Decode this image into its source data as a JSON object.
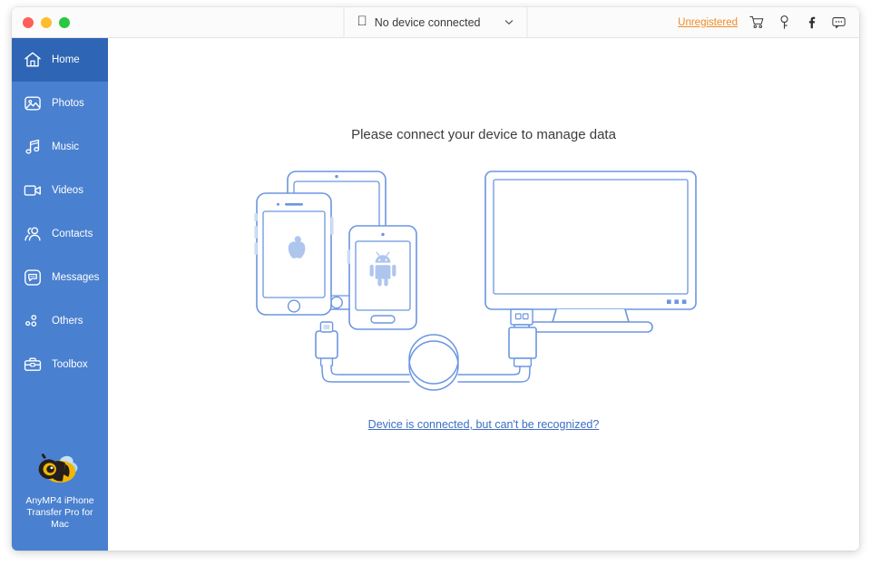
{
  "window": {
    "traffic_lights": [
      {
        "name": "close",
        "color": "#ff5f57"
      },
      {
        "name": "minimize",
        "color": "#febc2e"
      },
      {
        "name": "zoom",
        "color": "#28c840"
      }
    ]
  },
  "titlebar": {
    "device_selector": {
      "icon": "apple-icon",
      "value": "No device connected",
      "chevron": "chevron-down-icon"
    },
    "right": {
      "unregistered_label": "Unregistered",
      "unregistered_color": "#f08c28",
      "icons": [
        {
          "name": "cart-icon",
          "label": "Cart"
        },
        {
          "name": "key-icon",
          "label": "Register key"
        },
        {
          "name": "facebook-icon",
          "label": "Facebook"
        },
        {
          "name": "feedback-icon",
          "label": "Feedback"
        }
      ]
    }
  },
  "sidebar": {
    "background": "#4a80d0",
    "active_background": "#2e66b5",
    "items": [
      {
        "label": "Home",
        "icon": "home-icon",
        "active": true
      },
      {
        "label": "Photos",
        "icon": "photos-icon",
        "active": false
      },
      {
        "label": "Music",
        "icon": "music-icon",
        "active": false
      },
      {
        "label": "Videos",
        "icon": "videos-icon",
        "active": false
      },
      {
        "label": "Contacts",
        "icon": "contacts-icon",
        "active": false
      },
      {
        "label": "Messages",
        "icon": "messages-icon",
        "active": false
      },
      {
        "label": "Others",
        "icon": "others-icon",
        "active": false
      },
      {
        "label": "Toolbox",
        "icon": "toolbox-icon",
        "active": false
      }
    ],
    "brand": {
      "logo": "bee-logo",
      "name": "AnyMP4 iPhone Transfer Pro for Mac"
    }
  },
  "main": {
    "headline": "Please connect your device to manage data",
    "illustration": {
      "name": "connect-device-illustration",
      "line_color": "#6b96e0",
      "parts": [
        "tablet",
        "iphone",
        "android-phone",
        "monitor",
        "lightning-connector",
        "usb-connector",
        "cable"
      ]
    },
    "help_link": "Device is connected, but can't be recognized?",
    "help_link_color": "#3d6fc4"
  }
}
